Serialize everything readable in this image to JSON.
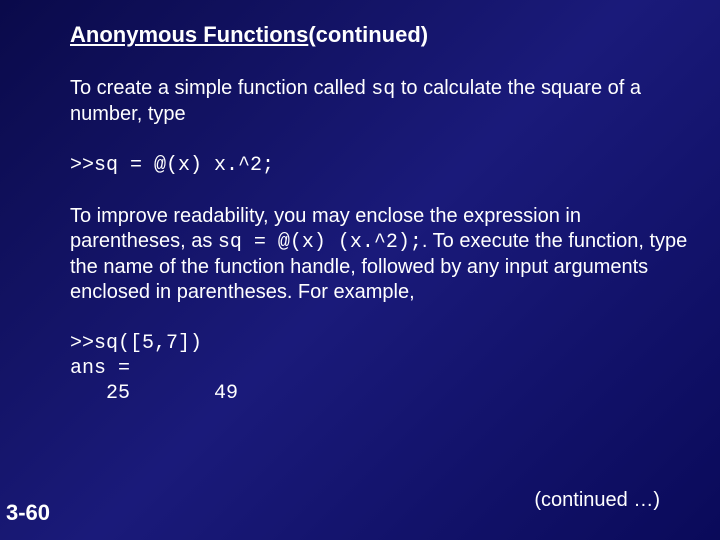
{
  "slide": {
    "title_underlined": "Anonymous Functions",
    "title_rest": " (continued)",
    "para1_a": "To create a simple function called ",
    "para1_code": "sq",
    "para1_b": " to calculate the square of a number, type",
    "code1": ">>sq = @(x) x.^2;",
    "para2_a": "To improve readability, you may enclose the expression in parentheses, as ",
    "para2_code": "sq = @(x) (x.^2);",
    "para2_b": ". To execute the function, type the name of the function handle, followed by any input arguments enclosed in parentheses. For example,",
    "code2": ">>sq([5,7])\nans =\n   25       49",
    "continued": "(continued …)",
    "page": "3-60"
  }
}
